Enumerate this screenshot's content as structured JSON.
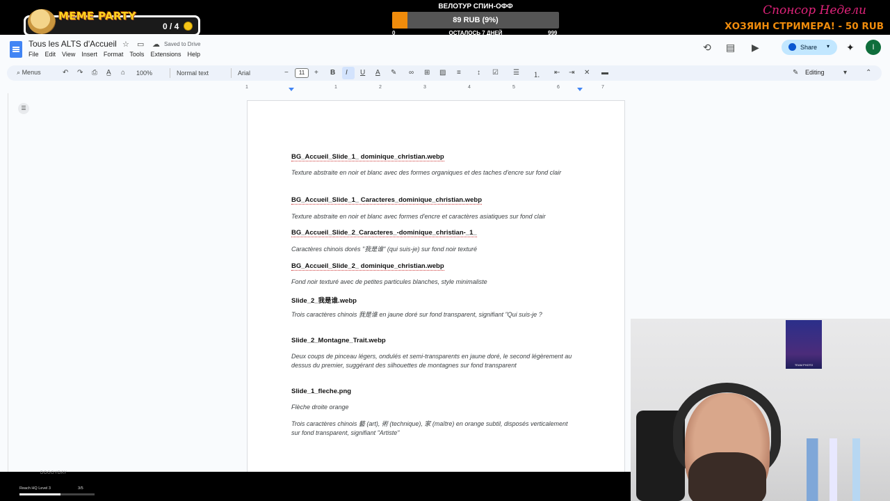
{
  "overlay": {
    "meme_party": {
      "title": "MEME PARTY",
      "count": "0 / 4"
    },
    "velotour": {
      "title": "ВЕЛОТУР СПИН-ОФФ",
      "progress_text": "89 RUB (9%)",
      "progress_fraction": 0.09,
      "min": "0",
      "remaining": "ОСТАЛОСЬ 7 ДНЕЙ",
      "max": "999",
      "fill_color": "#f08c0c"
    },
    "sponsor": {
      "line1": "Спонсор Недели",
      "line2": "ХОЗЯИН СТРИМЕРА! - 50 RUB"
    },
    "bottom": {
      "logo": "DOGGYDAY",
      "level": "Reach HQ Level 3",
      "count": "3/5",
      "progress_fraction": 0.55
    }
  },
  "docs": {
    "title": "Tous les ALTS d'Accueil",
    "saved_status": "Saved to Drive",
    "menu": [
      "File",
      "Edit",
      "View",
      "Insert",
      "Format",
      "Tools",
      "Extensions",
      "Help"
    ],
    "share_label": "Share",
    "avatar_initial": "I",
    "toolbar": {
      "search": "Menus",
      "zoom": "100%",
      "style": "Normal text",
      "font": "Arial",
      "font_size": "11",
      "mode": "Editing"
    },
    "ruler_labels": [
      "1",
      "1",
      "2",
      "3",
      "4",
      "5",
      "6",
      "7"
    ]
  },
  "document": {
    "entries": [
      {
        "heading": "BG_Accueil_Slide_1_ dominique_christian.webp",
        "desc": "Texture abstraite en noir et blanc avec des formes organiques et des taches d'encre sur fond clair"
      },
      {
        "heading": "BG_Accueil_Slide_1_ Caracteres_dominique_christian.webp",
        "desc": "Texture abstraite en noir et blanc avec formes d'encre et caractères asiatiques sur fond clair"
      },
      {
        "heading": "BG_Accueil_Slide_2_Caracteres_-dominique_christian-_1_",
        "desc": "Caractères chinois dorés \"我是谁\" (qui suis-je) sur fond noir texturé"
      },
      {
        "heading": "BG_Accueil_Slide_2_ dominique_christian.webp",
        "desc": "Fond noir texturé avec de petites particules blanches, style minimaliste"
      },
      {
        "heading": "Slide_2_我是谁.webp",
        "desc": "Trois caractères chinois 我是谁 en jaune doré sur fond transparent, signifiant \"Qui suis-je ?"
      },
      {
        "heading": "Slide_2_Montagne_Trait.webp",
        "desc": "Deux coups de pinceau légers, ondulés et semi-transparents en jaune doré, le second légèrement au dessus du premier, suggérant des silhouettes de montagnes sur fond transparent"
      },
      {
        "heading": "Slide_1_fleche.png",
        "desc": "Flèche droite orange"
      },
      {
        "heading": "",
        "desc": "Trois caractères chinois 藝 (art), 術 (technique), 家 (maître) en orange subtil, disposés verticalement sur fond transparent, signifiant \"Artiste\""
      }
    ]
  },
  "webcam": {
    "poster_text": "TEAM PHOTO"
  }
}
